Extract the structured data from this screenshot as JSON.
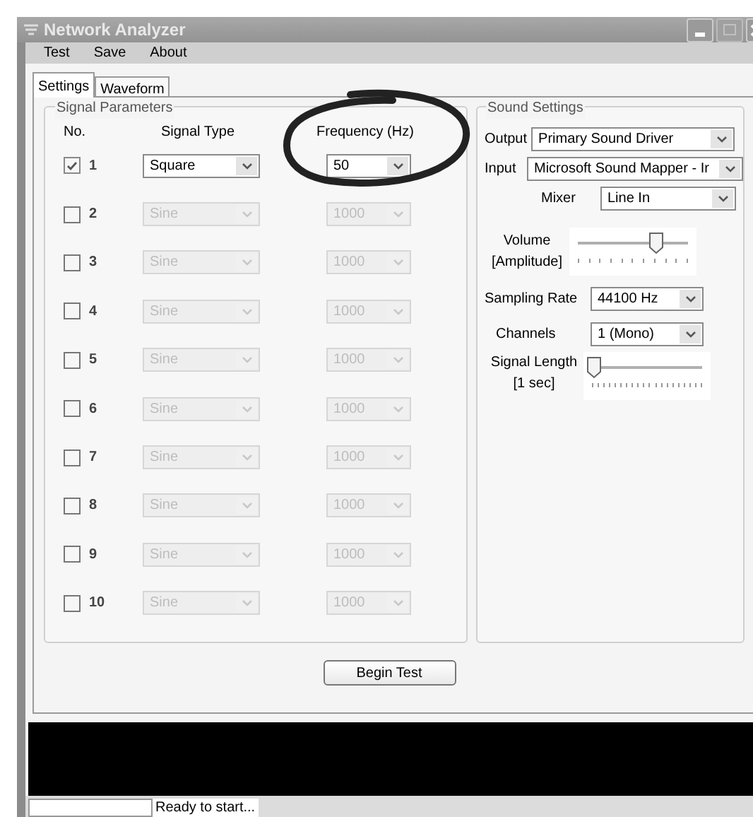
{
  "window": {
    "title": "Network Analyzer"
  },
  "menu": [
    "Test",
    "Save",
    "About"
  ],
  "tabs": [
    {
      "label": "Settings",
      "selected": true
    },
    {
      "label": "Waveform",
      "selected": false
    }
  ],
  "signal_parameters": {
    "title": "Signal Parameters",
    "headers": [
      "No.",
      "Signal Type",
      "Frequency (Hz)"
    ],
    "rows": [
      {
        "number": "1",
        "checked": true,
        "signal_type": "Square",
        "frequency": "50"
      },
      {
        "number": "2",
        "checked": false,
        "signal_type": "Sine",
        "frequency": "1000"
      },
      {
        "number": "3",
        "checked": false,
        "signal_type": "Sine",
        "frequency": "1000"
      },
      {
        "number": "4",
        "checked": false,
        "signal_type": "Sine",
        "frequency": "1000"
      },
      {
        "number": "5",
        "checked": false,
        "signal_type": "Sine",
        "frequency": "1000"
      },
      {
        "number": "6",
        "checked": false,
        "signal_type": "Sine",
        "frequency": "1000"
      },
      {
        "number": "7",
        "checked": false,
        "signal_type": "Sine",
        "frequency": "1000"
      },
      {
        "number": "8",
        "checked": false,
        "signal_type": "Sine",
        "frequency": "1000"
      },
      {
        "number": "9",
        "checked": false,
        "signal_type": "Sine",
        "frequency": "1000"
      },
      {
        "number": "10",
        "checked": false,
        "signal_type": "Sine",
        "frequency": "1000"
      }
    ]
  },
  "sound_settings": {
    "title": "Sound Settings",
    "output": {
      "label": "Output",
      "value": "Primary Sound Driver"
    },
    "input": {
      "label": "Input",
      "value": "Microsoft Sound Mapper - Ir"
    },
    "mixer": {
      "label": "Mixer",
      "value": "Line In"
    },
    "volume": {
      "label": "Volume",
      "sublabel": "[Amplitude]",
      "level": 0.72
    },
    "sampling_rate": {
      "label": "Sampling Rate",
      "value": "44100 Hz"
    },
    "channels": {
      "label": "Channels",
      "value": "1 (Mono)"
    },
    "signal_length": {
      "label": "Signal Length",
      "sublabel": "[1 sec]",
      "level": 0.03
    }
  },
  "begin_button": "Begin Test",
  "status_bar": {
    "text": "Ready to start..."
  }
}
